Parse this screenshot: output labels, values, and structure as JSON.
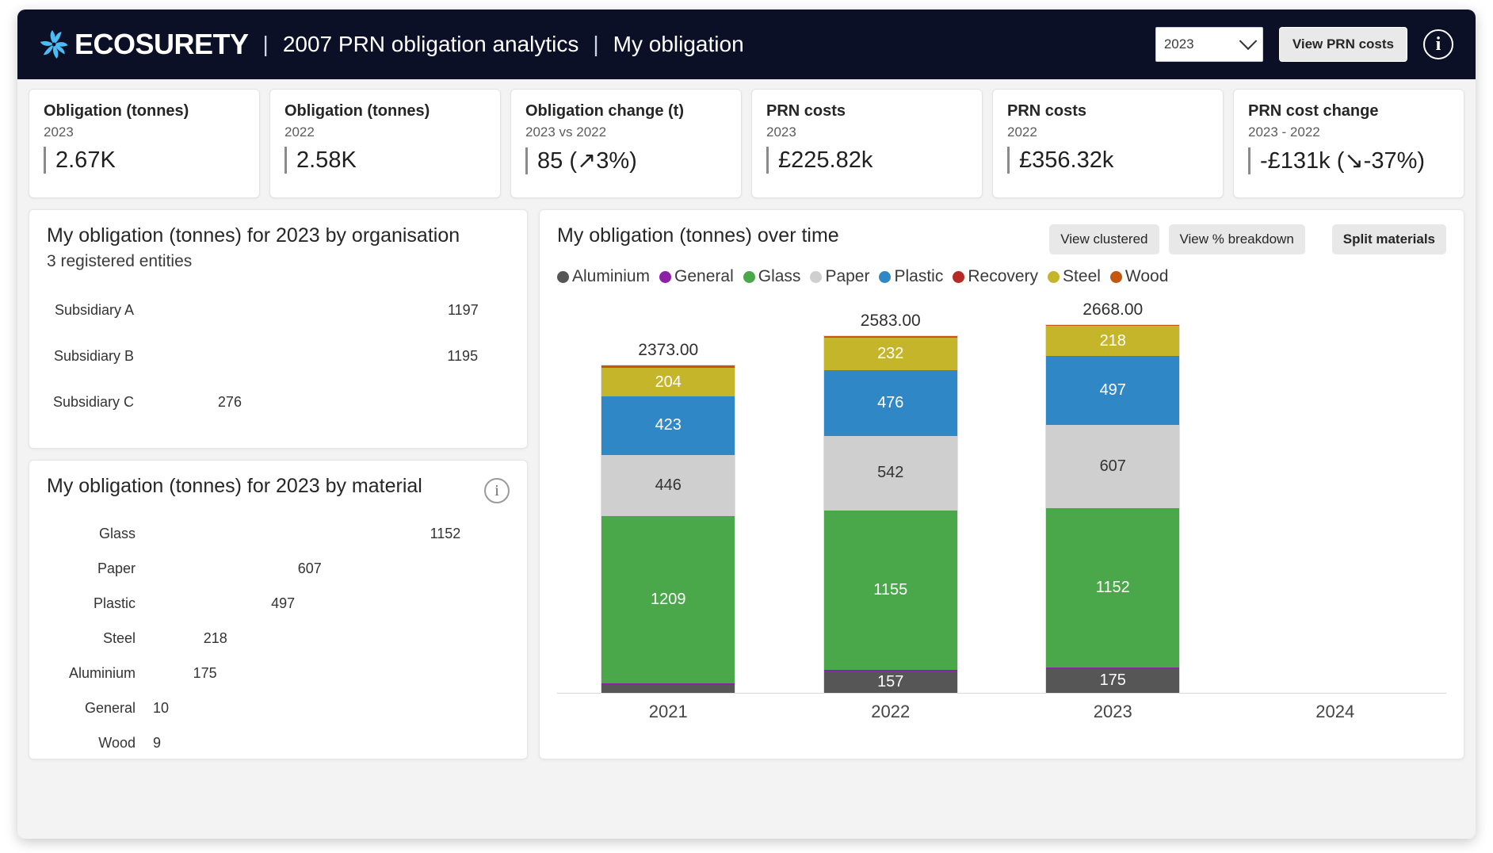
{
  "header": {
    "brand": "ECOSURETY",
    "sep": "|",
    "title_1": "2007 PRN obligation analytics",
    "title_2": "My obligation",
    "year_value": "2023",
    "prn_costs_button": "View PRN costs",
    "info_glyph": "i"
  },
  "kpis": [
    {
      "title": "Obligation (tonnes)",
      "sub": "2023",
      "value": "2.67K"
    },
    {
      "title": "Obligation (tonnes)",
      "sub": "2022",
      "value": "2.58K"
    },
    {
      "title": "Obligation change (t)",
      "sub": "2023 vs 2022",
      "value": "85 (↗3%)"
    },
    {
      "title": "PRN costs",
      "sub": "2023",
      "value": "£225.82k"
    },
    {
      "title": "PRN costs",
      "sub": "2022",
      "value": "£356.32k"
    },
    {
      "title": "PRN cost change",
      "sub": "2023 - 2022",
      "value": "-£131k (↘-37%)"
    }
  ],
  "org_panel": {
    "title": "My obligation (tonnes) for 2023 by organisation",
    "subtitle": "3 registered entities"
  },
  "material_panel": {
    "title": "My obligation (tonnes) for 2023 by material",
    "info_glyph": "i"
  },
  "time_panel": {
    "title": "My obligation (tonnes) over time",
    "buttons": [
      {
        "label": "View clustered",
        "bold": false
      },
      {
        "label": "View % breakdown",
        "bold": false
      },
      {
        "label": "Split materials",
        "bold": true
      }
    ]
  },
  "chart_data": [
    {
      "id": "org",
      "type": "bar",
      "orientation": "horizontal",
      "title": "My obligation (tonnes) for 2023 by organisation",
      "subtitle": "3 registered entities",
      "categories": [
        "Subsidiary A",
        "Subsidiary B",
        "Subsidiary C"
      ],
      "values": [
        1197,
        1195,
        276
      ],
      "labels": [
        "1197",
        "1195",
        "276"
      ],
      "color": "#4cbcf5",
      "xlim": [
        0,
        1270
      ],
      "grid": false,
      "legend": "none"
    },
    {
      "id": "material",
      "type": "bar",
      "orientation": "horizontal",
      "title": "My obligation (tonnes) for 2023 by material",
      "categories": [
        "Glass",
        "Paper",
        "Plastic",
        "Steel",
        "Aluminium",
        "General",
        "Wood"
      ],
      "values": [
        1152,
        607,
        497,
        218,
        175,
        10,
        9
      ],
      "labels": [
        "1152",
        "607",
        "497",
        "218",
        "175",
        "10",
        "9"
      ],
      "colors": [
        "#4aa84a",
        "#cfcfcf",
        "#2f87c6",
        "#c4b52b",
        "#565656",
        "#8c21a8",
        "#c4560e"
      ],
      "xlim": [
        0,
        1235
      ],
      "grid": false,
      "legend": "none"
    },
    {
      "id": "over_time",
      "type": "bar",
      "subtype": "stacked",
      "orientation": "vertical",
      "title": "My obligation (tonnes) over time",
      "xlabel": "",
      "ylabel": "",
      "categories": [
        "2021",
        "2022",
        "2023",
        "2024"
      ],
      "totals": [
        2373.0,
        2583.0,
        2668.0,
        null
      ],
      "total_labels": [
        "2373.00",
        "2583.00",
        "2668.00",
        ""
      ],
      "ylim": [
        0,
        2700
      ],
      "grid": false,
      "legend_position": "top-left",
      "series": [
        {
          "name": "Aluminium",
          "color": "#565656",
          "values": [
            55,
            157,
            175
          ],
          "labels": [
            "",
            "157",
            "175"
          ]
        },
        {
          "name": "General",
          "color": "#8c21a8",
          "values": [
            16,
            10,
            10
          ],
          "labels": [
            "",
            "",
            ""
          ]
        },
        {
          "name": "Glass",
          "color": "#4aa84a",
          "values": [
            1209,
            1155,
            1152
          ],
          "labels": [
            "1209",
            "1155",
            "1152"
          ]
        },
        {
          "name": "Paper",
          "color": "#cfcfcf",
          "values": [
            446,
            542,
            607
          ],
          "labels": [
            "446",
            "542",
            "607"
          ]
        },
        {
          "name": "Plastic",
          "color": "#2f87c6",
          "values": [
            423,
            476,
            497
          ],
          "labels": [
            "423",
            "476",
            "497"
          ]
        },
        {
          "name": "Recovery",
          "color": "#b52a24",
          "values": [
            0,
            0,
            0
          ],
          "labels": [
            "",
            "",
            ""
          ]
        },
        {
          "name": "Steel",
          "color": "#c4b52b",
          "values": [
            204,
            232,
            218
          ],
          "labels": [
            "204",
            "232",
            "218"
          ]
        },
        {
          "name": "Wood",
          "color": "#c4560e",
          "values": [
            20,
            11,
            9
          ],
          "labels": [
            "",
            "",
            ""
          ]
        }
      ]
    }
  ]
}
